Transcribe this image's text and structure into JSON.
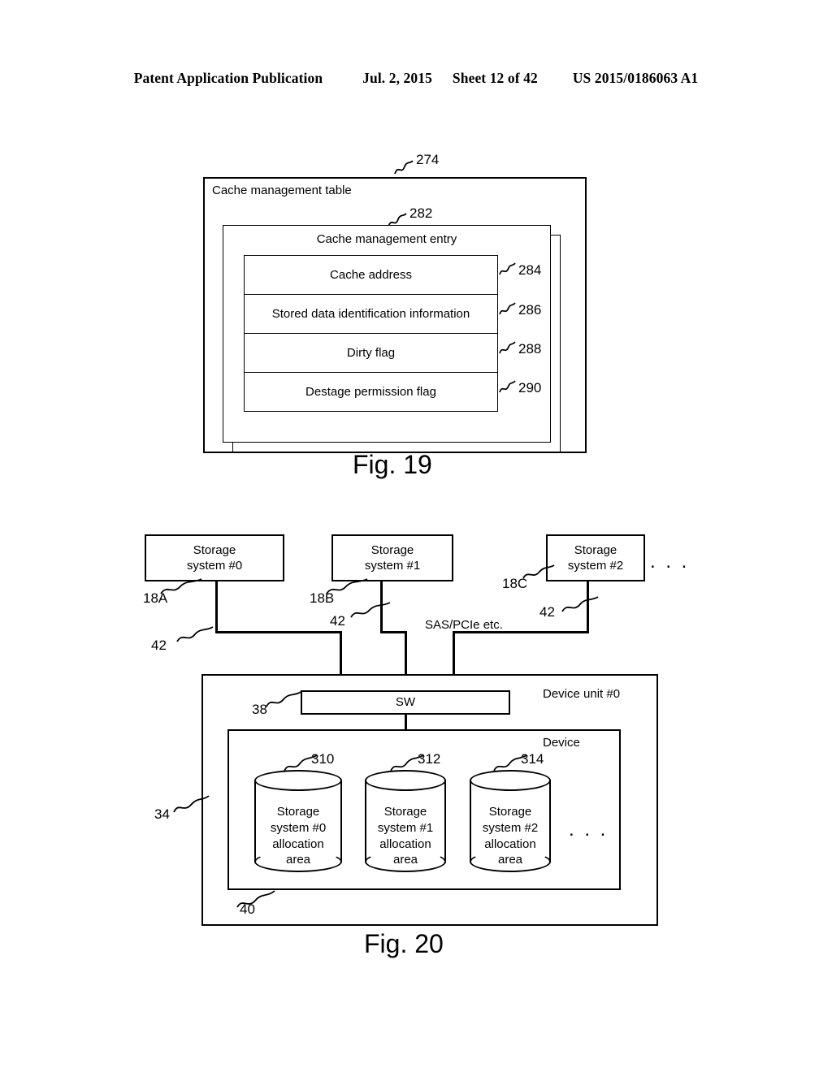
{
  "header": {
    "publication": "Patent Application Publication",
    "date": "Jul. 2, 2015",
    "sheet": "Sheet 12 of 42",
    "docnum": "US 2015/0186063 A1"
  },
  "fig19": {
    "caption": "Fig. 19",
    "table_label": "Cache management table",
    "table_ref": "274",
    "entry_label": "Cache management entry",
    "entry_ref": "282",
    "rows": [
      {
        "label": "Cache address",
        "ref": "284"
      },
      {
        "label": "Stored data identification  information",
        "ref": "286"
      },
      {
        "label": "Dirty flag",
        "ref": "288"
      },
      {
        "label": "Destage permission flag",
        "ref": "290"
      }
    ]
  },
  "fig20": {
    "caption": "Fig. 20",
    "storage_systems": [
      {
        "line1": "Storage",
        "line2": "system #0",
        "ref": "18A",
        "link_ref": "42"
      },
      {
        "line1": "Storage",
        "line2": "system #1",
        "ref": "18B",
        "link_ref": "42"
      },
      {
        "line1": "Storage",
        "line2": "system #2",
        "ref": "18C",
        "link_ref": "42"
      }
    ],
    "storage_ellipsis": ". . .",
    "bus_label": "SAS/PCIe etc.",
    "device_unit_label": "Device unit #0",
    "device_unit_ref": "34",
    "switch_label": "SW",
    "switch_ref": "38",
    "device_label": "Device",
    "device_ref": "40",
    "allocation_areas": [
      {
        "line1": "Storage",
        "line2": "system #0",
        "line3": "allocation",
        "line4": "area",
        "ref": "310"
      },
      {
        "line1": "Storage",
        "line2": "system #1",
        "line3": "allocation",
        "line4": "area",
        "ref": "312"
      },
      {
        "line1": "Storage",
        "line2": "system #2",
        "line3": "allocation",
        "line4": "area",
        "ref": "314"
      }
    ],
    "device_ellipsis": ". . ."
  }
}
